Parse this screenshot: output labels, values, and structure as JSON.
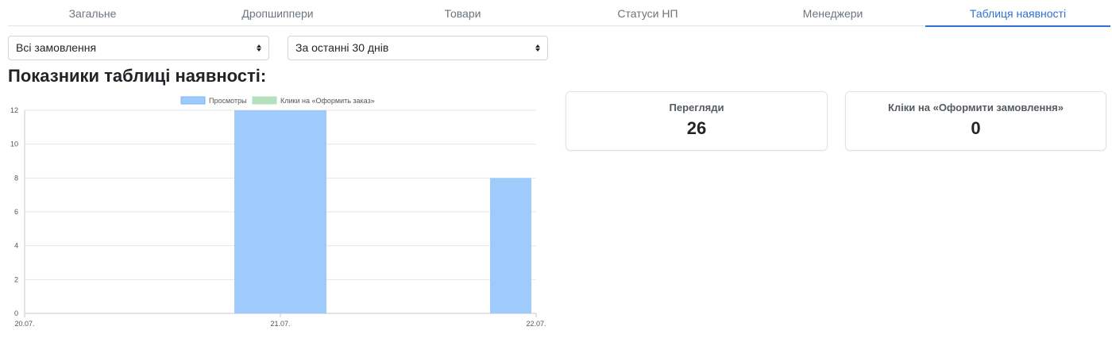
{
  "tabs": [
    {
      "label": "Загальне",
      "active": false
    },
    {
      "label": "Дропшиппери",
      "active": false
    },
    {
      "label": "Товари",
      "active": false
    },
    {
      "label": "Статуси НП",
      "active": false
    },
    {
      "label": "Менеджери",
      "active": false
    },
    {
      "label": "Таблиця наявності",
      "active": true
    }
  ],
  "filters": {
    "orders": "Всі замовлення",
    "period": "За останні 30 днів"
  },
  "heading": "Показники таблиці наявності:",
  "stats": {
    "views": {
      "label": "Перегляди",
      "value": "26"
    },
    "clicks": {
      "label": "Кліки на «Оформити замовлення»",
      "value": "0"
    }
  },
  "colors": {
    "accent": "#2f6fd3",
    "views_bar": "#9ecbfb",
    "views_legend_border": "#7fb6f0",
    "clicks_bar": "#b5dfbd",
    "grid": "#e5e5e5"
  },
  "chart_data": {
    "type": "bar",
    "categories": [
      "20.07.",
      "21.07.",
      "22.07."
    ],
    "series": [
      {
        "name": "Просмотры",
        "values": [
          0,
          12,
          8
        ]
      },
      {
        "name": "Клики на «Оформить заказ»",
        "values": [
          0,
          0,
          0
        ]
      }
    ],
    "ylim": [
      0,
      12
    ],
    "yticks": [
      0,
      2,
      4,
      6,
      8,
      10,
      12
    ],
    "grid": true,
    "legend_position": "top-center"
  }
}
